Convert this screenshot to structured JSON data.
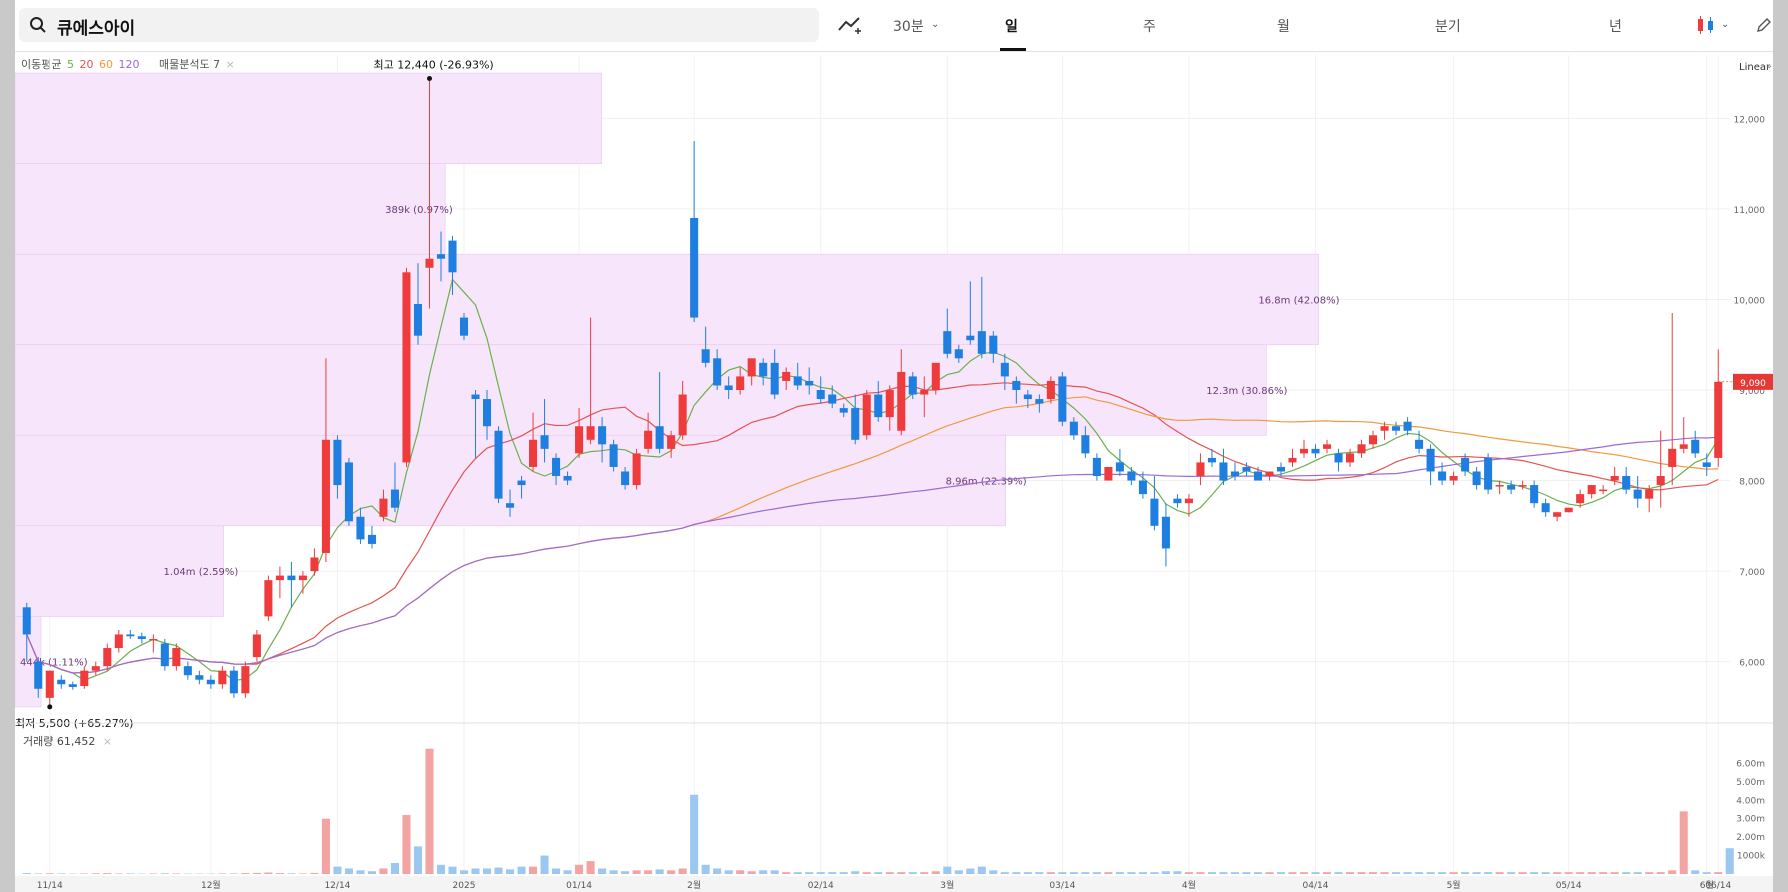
{
  "search": {
    "value": "큐에스아이"
  },
  "toolbar": {
    "interval": "30분",
    "tabs": [
      "일",
      "주",
      "월",
      "분기",
      "년"
    ],
    "active_tab": "일"
  },
  "legend": {
    "ma_label": "이동평균",
    "ma_periods": [
      "5",
      "20",
      "60",
      "120"
    ],
    "ma_colors": [
      "#6ab04c",
      "#e55353",
      "#f09a3e",
      "#9b6bd6"
    ],
    "volume_profile_label": "매물분석도 7"
  },
  "scale_label": "Linear",
  "price_badge": "9,090",
  "volume_label": "거래량 61,452",
  "annotations": {
    "high": "최고 12,440 (-26.93%)",
    "low": "최저 5,500 (+65.27%)"
  },
  "chart_data": {
    "type": "candlestick",
    "ylim": [
      5300,
      12700
    ],
    "yticks": [
      "12,000",
      "11,000",
      "10,000",
      "9,000",
      "8,000",
      "7,000",
      "6,000"
    ],
    "xticks": [
      "11/14",
      "12월",
      "12/14",
      "2025",
      "01/14",
      "2월",
      "02/14",
      "3월",
      "03/14",
      "4월",
      "04/14",
      "5월",
      "05/14",
      "6월",
      "06/14"
    ],
    "volume_ticks": [
      "6.00m",
      "5.00m",
      "4.00m",
      "3.00m",
      "2.00m",
      "1000k"
    ],
    "up_color": "#ef3b3b",
    "down_color": "#1e7fe0",
    "volume_profile": [
      {
        "label": "16.8m (42.08%)",
        "from": 9500,
        "to": 10500,
        "width": 1.0
      },
      {
        "label": "12.3m (30.86%)",
        "from": 8500,
        "to": 9500,
        "width": 0.96
      },
      {
        "label": "8.96m (22.39%)",
        "from": 7500,
        "to": 8500,
        "width": 0.76
      },
      {
        "label": "1.04m (2.59%)",
        "from": 6500,
        "to": 7500,
        "width": 0.16
      },
      {
        "label": "389k (0.97%)",
        "from": 10500,
        "to": 11500,
        "width": 0.33
      },
      {
        "label": "444k (1.11%)",
        "from": 5500,
        "to": 6500,
        "width": 0.02
      },
      {
        "label": "",
        "from": 11500,
        "to": 12500,
        "width": 0.45
      }
    ],
    "candles": [
      {
        "o": 6600,
        "h": 6650,
        "c": 6300,
        "l": 6000
      },
      {
        "o": 6000,
        "h": 6050,
        "c": 5700,
        "l": 5600
      },
      {
        "o": 5600,
        "h": 5900,
        "c": 5900,
        "l": 5500
      },
      {
        "o": 5800,
        "h": 5850,
        "c": 5750,
        "l": 5700
      },
      {
        "o": 5750,
        "h": 5780,
        "c": 5720,
        "l": 5690
      },
      {
        "o": 5730,
        "h": 5950,
        "c": 5900,
        "l": 5700
      },
      {
        "o": 5900,
        "h": 6000,
        "c": 5950,
        "l": 5850
      },
      {
        "o": 5950,
        "h": 6200,
        "c": 6150,
        "l": 5900
      },
      {
        "o": 6150,
        "h": 6350,
        "c": 6300,
        "l": 6100
      },
      {
        "o": 6300,
        "h": 6350,
        "c": 6280,
        "l": 6250
      },
      {
        "o": 6280,
        "h": 6320,
        "c": 6250,
        "l": 6200
      },
      {
        "o": 6250,
        "h": 6300,
        "c": 6250,
        "l": 6100
      },
      {
        "o": 6200,
        "h": 6250,
        "c": 5950,
        "l": 5900
      },
      {
        "o": 5950,
        "h": 6200,
        "c": 6150,
        "l": 5900
      },
      {
        "o": 5950,
        "h": 6000,
        "c": 5850,
        "l": 5800
      },
      {
        "o": 5850,
        "h": 5900,
        "c": 5800,
        "l": 5750
      },
      {
        "o": 5800,
        "h": 5850,
        "c": 5750,
        "l": 5700
      },
      {
        "o": 5750,
        "h": 5950,
        "c": 5900,
        "l": 5700
      },
      {
        "o": 5900,
        "h": 5950,
        "c": 5650,
        "l": 5600
      },
      {
        "o": 5650,
        "h": 6000,
        "c": 5950,
        "l": 5600
      },
      {
        "o": 6050,
        "h": 6350,
        "c": 6300,
        "l": 6000
      },
      {
        "o": 6500,
        "h": 6950,
        "c": 6900,
        "l": 6450
      },
      {
        "o": 6900,
        "h": 7050,
        "c": 6950,
        "l": 6700
      },
      {
        "o": 6950,
        "h": 7100,
        "c": 6900,
        "l": 6600
      },
      {
        "o": 6900,
        "h": 7000,
        "c": 6950,
        "l": 6750
      },
      {
        "o": 7000,
        "h": 7250,
        "c": 7150,
        "l": 6950
      },
      {
        "o": 7200,
        "h": 9350,
        "c": 8450,
        "l": 7100
      },
      {
        "o": 8450,
        "h": 8500,
        "c": 7950,
        "l": 7800
      },
      {
        "o": 8200,
        "h": 8250,
        "c": 7550,
        "l": 7500
      },
      {
        "o": 7600,
        "h": 7700,
        "c": 7350,
        "l": 7300
      },
      {
        "o": 7400,
        "h": 7500,
        "c": 7300,
        "l": 7250
      },
      {
        "o": 7600,
        "h": 7900,
        "c": 7800,
        "l": 7550
      },
      {
        "o": 7900,
        "h": 8200,
        "c": 7700,
        "l": 7650
      },
      {
        "o": 8200,
        "h": 10350,
        "c": 10300,
        "l": 8150
      },
      {
        "o": 9950,
        "h": 10400,
        "c": 9600,
        "l": 9500
      },
      {
        "o": 10350,
        "h": 12440,
        "c": 10450,
        "l": 9900
      },
      {
        "o": 10500,
        "h": 10750,
        "c": 10450,
        "l": 10200
      },
      {
        "o": 10650,
        "h": 10700,
        "c": 10300,
        "l": 10050
      },
      {
        "o": 9800,
        "h": 9850,
        "c": 9600,
        "l": 9550
      },
      {
        "o": 8950,
        "h": 9000,
        "c": 8900,
        "l": 8250
      },
      {
        "o": 8900,
        "h": 9000,
        "c": 8600,
        "l": 8450
      },
      {
        "o": 8550,
        "h": 8600,
        "c": 7800,
        "l": 7750
      },
      {
        "o": 7750,
        "h": 7900,
        "c": 7700,
        "l": 7600
      },
      {
        "o": 8000,
        "h": 8050,
        "c": 7950,
        "l": 7800
      },
      {
        "o": 8150,
        "h": 8750,
        "c": 8450,
        "l": 8100
      },
      {
        "o": 8500,
        "h": 8900,
        "c": 8350,
        "l": 8200
      },
      {
        "o": 8250,
        "h": 8300,
        "c": 8050,
        "l": 7950
      },
      {
        "o": 8050,
        "h": 8100,
        "c": 8000,
        "l": 7950
      },
      {
        "o": 8300,
        "h": 8800,
        "c": 8600,
        "l": 8250
      },
      {
        "o": 8450,
        "h": 9800,
        "c": 8600,
        "l": 8400
      },
      {
        "o": 8600,
        "h": 8700,
        "c": 8400,
        "l": 8200
      },
      {
        "o": 8400,
        "h": 8450,
        "c": 8150,
        "l": 8100
      },
      {
        "o": 8100,
        "h": 8150,
        "c": 7950,
        "l": 7900
      },
      {
        "o": 7950,
        "h": 8350,
        "c": 8300,
        "l": 7900
      },
      {
        "o": 8350,
        "h": 8750,
        "c": 8550,
        "l": 8300
      },
      {
        "o": 8600,
        "h": 9200,
        "c": 8350,
        "l": 8300
      },
      {
        "o": 8350,
        "h": 8550,
        "c": 8500,
        "l": 8250
      },
      {
        "o": 8500,
        "h": 9100,
        "c": 8950,
        "l": 8450
      },
      {
        "o": 10900,
        "h": 11750,
        "c": 9800,
        "l": 9750
      },
      {
        "o": 9450,
        "h": 9700,
        "c": 9300,
        "l": 9250
      },
      {
        "o": 9350,
        "h": 9450,
        "c": 9050,
        "l": 9000
      },
      {
        "o": 9050,
        "h": 9150,
        "c": 9000,
        "l": 8900
      },
      {
        "o": 9000,
        "h": 9250,
        "c": 9150,
        "l": 8950
      },
      {
        "o": 9150,
        "h": 9300,
        "c": 9350,
        "l": 9050
      },
      {
        "o": 9300,
        "h": 9350,
        "c": 9150,
        "l": 9050
      },
      {
        "o": 9300,
        "h": 9450,
        "c": 8950,
        "l": 8900
      },
      {
        "o": 9100,
        "h": 9250,
        "c": 9200,
        "l": 9000
      },
      {
        "o": 9150,
        "h": 9300,
        "c": 9050,
        "l": 9000
      },
      {
        "o": 9100,
        "h": 9250,
        "c": 9050,
        "l": 8950
      },
      {
        "o": 9000,
        "h": 9150,
        "c": 8900,
        "l": 8850
      },
      {
        "o": 8950,
        "h": 9050,
        "c": 8850,
        "l": 8800
      },
      {
        "o": 8800,
        "h": 8850,
        "c": 8750,
        "l": 8700
      },
      {
        "o": 8800,
        "h": 8950,
        "c": 8450,
        "l": 8400
      },
      {
        "o": 8500,
        "h": 9000,
        "c": 8950,
        "l": 8450
      },
      {
        "o": 8950,
        "h": 9100,
        "c": 8700,
        "l": 8650
      },
      {
        "o": 8700,
        "h": 9050,
        "c": 9000,
        "l": 8550
      },
      {
        "o": 8550,
        "h": 9450,
        "c": 9200,
        "l": 8500
      },
      {
        "o": 9150,
        "h": 9200,
        "c": 8950,
        "l": 8900
      },
      {
        "o": 8950,
        "h": 9150,
        "c": 9000,
        "l": 8700
      },
      {
        "o": 9000,
        "h": 9300,
        "c": 9300,
        "l": 8950
      },
      {
        "o": 9650,
        "h": 9900,
        "c": 9400,
        "l": 9350
      },
      {
        "o": 9450,
        "h": 9500,
        "c": 9350,
        "l": 9300
      },
      {
        "o": 9600,
        "h": 10200,
        "c": 9550,
        "l": 9500
      },
      {
        "o": 9650,
        "h": 10250,
        "c": 9400,
        "l": 9350
      },
      {
        "o": 9600,
        "h": 9650,
        "c": 9400,
        "l": 9300
      },
      {
        "o": 9300,
        "h": 9400,
        "c": 9150,
        "l": 9000
      },
      {
        "o": 9100,
        "h": 9150,
        "c": 9000,
        "l": 8850
      },
      {
        "o": 8950,
        "h": 9000,
        "c": 8900,
        "l": 8800
      },
      {
        "o": 8900,
        "h": 8950,
        "c": 8850,
        "l": 8750
      },
      {
        "o": 8900,
        "h": 9150,
        "c": 9100,
        "l": 8850
      },
      {
        "o": 9150,
        "h": 9200,
        "c": 8650,
        "l": 8600
      },
      {
        "o": 8650,
        "h": 8700,
        "c": 8500,
        "l": 8450
      },
      {
        "o": 8500,
        "h": 8600,
        "c": 8300,
        "l": 8250
      },
      {
        "o": 8250,
        "h": 8300,
        "c": 8050,
        "l": 8000
      },
      {
        "o": 8000,
        "h": 8150,
        "c": 8150,
        "l": 8000
      },
      {
        "o": 8200,
        "h": 8350,
        "c": 8100,
        "l": 8050
      },
      {
        "o": 8100,
        "h": 8150,
        "c": 8000,
        "l": 7950
      },
      {
        "o": 8000,
        "h": 8100,
        "c": 7850,
        "l": 7800
      },
      {
        "o": 7800,
        "h": 8050,
        "c": 7500,
        "l": 7450
      },
      {
        "o": 7600,
        "h": 7750,
        "c": 7250,
        "l": 7050
      },
      {
        "o": 7800,
        "h": 7850,
        "c": 7750,
        "l": 7700
      },
      {
        "o": 7750,
        "h": 7850,
        "c": 7800,
        "l": 7600
      },
      {
        "o": 8050,
        "h": 8300,
        "c": 8200,
        "l": 7950
      },
      {
        "o": 8250,
        "h": 8350,
        "c": 8200,
        "l": 8150
      },
      {
        "o": 8200,
        "h": 8350,
        "c": 8000,
        "l": 7950
      },
      {
        "o": 8100,
        "h": 8200,
        "c": 8050,
        "l": 8000
      },
      {
        "o": 8150,
        "h": 8200,
        "c": 8100,
        "l": 8050
      },
      {
        "o": 8100,
        "h": 8150,
        "c": 8000,
        "l": 8000
      },
      {
        "o": 8050,
        "h": 8100,
        "c": 8100,
        "l": 8000
      },
      {
        "o": 8150,
        "h": 8200,
        "c": 8100,
        "l": 8050
      },
      {
        "o": 8200,
        "h": 8350,
        "c": 8250,
        "l": 8150
      },
      {
        "o": 8300,
        "h": 8450,
        "c": 8350,
        "l": 8250
      },
      {
        "o": 8350,
        "h": 8400,
        "c": 8300,
        "l": 8250
      },
      {
        "o": 8350,
        "h": 8450,
        "c": 8400,
        "l": 8300
      },
      {
        "o": 8300,
        "h": 8350,
        "c": 8200,
        "l": 8100
      },
      {
        "o": 8200,
        "h": 8350,
        "c": 8300,
        "l": 8150
      },
      {
        "o": 8300,
        "h": 8450,
        "c": 8400,
        "l": 8250
      },
      {
        "o": 8400,
        "h": 8550,
        "c": 8500,
        "l": 8350
      },
      {
        "o": 8550,
        "h": 8650,
        "c": 8600,
        "l": 8450
      },
      {
        "o": 8600,
        "h": 8650,
        "c": 8550,
        "l": 8500
      },
      {
        "o": 8650,
        "h": 8700,
        "c": 8550,
        "l": 8500
      },
      {
        "o": 8450,
        "h": 8550,
        "c": 8350,
        "l": 8300
      },
      {
        "o": 8350,
        "h": 8400,
        "c": 8100,
        "l": 7950
      },
      {
        "o": 8100,
        "h": 8200,
        "c": 8000,
        "l": 7950
      },
      {
        "o": 8000,
        "h": 8100,
        "c": 8050,
        "l": 7950
      },
      {
        "o": 8250,
        "h": 8300,
        "c": 8100,
        "l": 8050
      },
      {
        "o": 8100,
        "h": 8150,
        "c": 7950,
        "l": 7900
      },
      {
        "o": 8250,
        "h": 8300,
        "c": 7900,
        "l": 7850
      },
      {
        "o": 7950,
        "h": 8000,
        "c": 7950,
        "l": 7850
      },
      {
        "o": 7950,
        "h": 8000,
        "c": 7900,
        "l": 7850
      },
      {
        "o": 7950,
        "h": 8000,
        "c": 7950,
        "l": 7900
      },
      {
        "o": 7950,
        "h": 8000,
        "c": 7750,
        "l": 7700
      },
      {
        "o": 7750,
        "h": 7800,
        "c": 7650,
        "l": 7600
      },
      {
        "o": 7600,
        "h": 7650,
        "c": 7650,
        "l": 7550
      },
      {
        "o": 7650,
        "h": 7700,
        "c": 7700,
        "l": 7650
      },
      {
        "o": 7750,
        "h": 7900,
        "c": 7850,
        "l": 7700
      },
      {
        "o": 7850,
        "h": 7950,
        "c": 7950,
        "l": 7800
      },
      {
        "o": 7900,
        "h": 7950,
        "c": 7900,
        "l": 7850
      },
      {
        "o": 8000,
        "h": 8150,
        "c": 8050,
        "l": 7950
      },
      {
        "o": 8050,
        "h": 8150,
        "c": 7900,
        "l": 7850
      },
      {
        "o": 7900,
        "h": 8050,
        "c": 7800,
        "l": 7700
      },
      {
        "o": 7800,
        "h": 7950,
        "c": 7900,
        "l": 7650
      },
      {
        "o": 7950,
        "h": 8550,
        "c": 8050,
        "l": 7700
      },
      {
        "o": 8150,
        "h": 9850,
        "c": 8350,
        "l": 7950
      },
      {
        "o": 8350,
        "h": 8700,
        "c": 8400,
        "l": 8300
      },
      {
        "o": 8450,
        "h": 8550,
        "c": 8300,
        "l": 8250
      },
      {
        "o": 8200,
        "h": 8300,
        "c": 8150,
        "l": 8050
      },
      {
        "o": 8250,
        "h": 9450,
        "c": 9090,
        "l": 8150
      }
    ],
    "volume": [
      0.05,
      0.03,
      0.04,
      0.03,
      0.02,
      0.03,
      0.04,
      0.05,
      0.03,
      0.03,
      0.02,
      0.03,
      0.04,
      0.03,
      0.02,
      0.02,
      0.02,
      0.03,
      0.03,
      0.05,
      0.06,
      0.08,
      0.05,
      0.04,
      0.03,
      0.06,
      3.0,
      0.4,
      0.3,
      0.2,
      0.15,
      0.3,
      0.6,
      3.2,
      1.5,
      6.8,
      0.5,
      0.4,
      0.2,
      0.3,
      0.3,
      0.35,
      0.25,
      0.4,
      0.4,
      1.0,
      0.3,
      0.2,
      0.5,
      0.7,
      0.3,
      0.2,
      0.15,
      0.2,
      0.2,
      0.25,
      0.2,
      0.3,
      4.3,
      0.5,
      0.3,
      0.2,
      0.2,
      0.15,
      0.2,
      0.2,
      0.1,
      0.1,
      0.1,
      0.1,
      0.1,
      0.1,
      0.15,
      0.1,
      0.1,
      0.1,
      0.1,
      0.1,
      0.1,
      0.15,
      0.4,
      0.2,
      0.3,
      0.4,
      0.2,
      0.1,
      0.1,
      0.1,
      0.1,
      0.1,
      0.1,
      0.1,
      0.1,
      0.1,
      0.1,
      0.1,
      0.1,
      0.1,
      0.1,
      0.15,
      0.15,
      0.1,
      0.1,
      0.1,
      0.1,
      0.1,
      0.1,
      0.1,
      0.1,
      0.1,
      0.1,
      0.1,
      0.1,
      0.1,
      0.1,
      0.1,
      0.1,
      0.1,
      0.1,
      0.1,
      0.1,
      0.1,
      0.1,
      0.1,
      0.1,
      0.1,
      0.1,
      0.1,
      0.1,
      0.1,
      0.1,
      0.1,
      0.1,
      0.1,
      0.1,
      0.1,
      0.1,
      0.1,
      0.1,
      0.1,
      0.1,
      0.1,
      0.1,
      0.2,
      3.4,
      0.2,
      0.1,
      0.1,
      1.4
    ]
  }
}
